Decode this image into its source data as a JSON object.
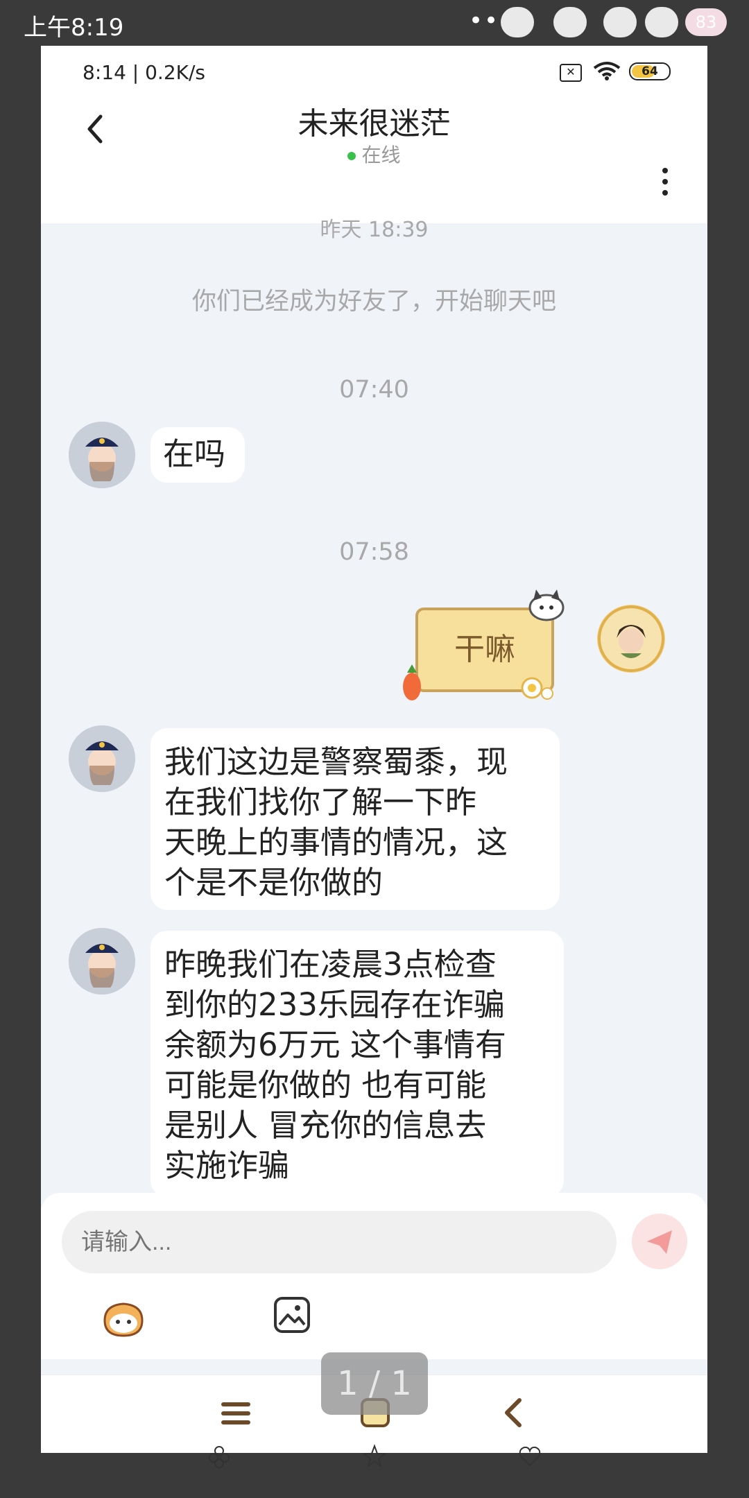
{
  "outer_status": {
    "time": "上午8:19",
    "dots": "•••",
    "badge": "83"
  },
  "inner_status": {
    "time": "8:14 | 0.2K/s",
    "battery": "64",
    "battery_level": 0.64
  },
  "header": {
    "title": "未来很迷茫",
    "status": "在线"
  },
  "messages": {
    "partial_time": "昨天 18:39",
    "system_note": "你们已经成为好友了，开始聊天吧",
    "time1": "07:40",
    "msg1": "在吗",
    "time2": "07:58",
    "sticker_text": "干嘛",
    "msg2": "我们这边是警察蜀黍，现\n在我们找你了解一下昨\n天晚上的事情的情况，这\n个是不是你做的",
    "msg3": "昨晚我们在凌晨3点检查\n到你的233乐园存在诈骗\n余额为6万元 这个事情有\n可能是你做的 也有可能\n是别人 冒充你的信息去\n实施诈骗"
  },
  "input": {
    "placeholder": "请输入..."
  },
  "page_indicator": "1 / 1",
  "colors": {
    "online_dot": "#39c24a",
    "accent_send": "#f08a8a",
    "bubble": "#ffffff",
    "chat_bg": "#f0f3f8"
  }
}
